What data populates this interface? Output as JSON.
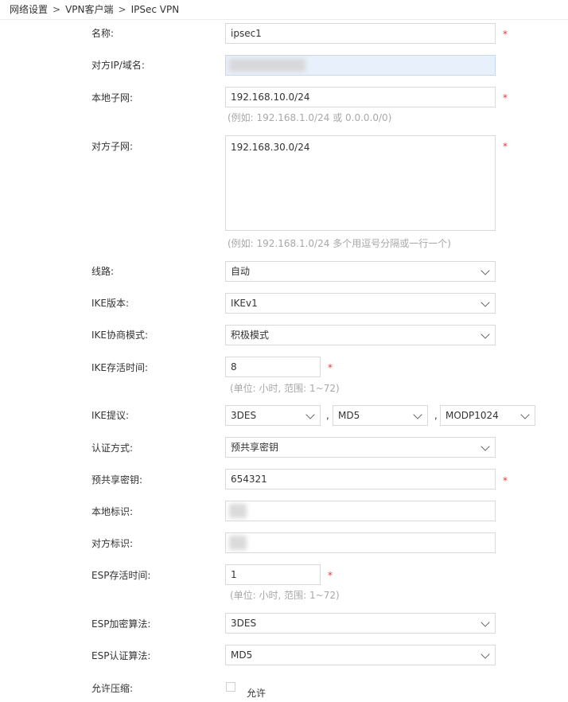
{
  "breadcrumb": {
    "items": [
      "网络设置",
      "VPN客户端",
      "IPSec VPN"
    ],
    "separator": ">"
  },
  "required_mark": "*",
  "form": {
    "name": {
      "label": "名称:",
      "value": "ipsec1"
    },
    "remote_ip": {
      "label": "对方IP/域名:",
      "value": ""
    },
    "local_subnet": {
      "label": "本地子网:",
      "value": "192.168.10.0/24",
      "hint": "(例如: 192.168.1.0/24 或 0.0.0.0/0)"
    },
    "remote_subnet": {
      "label": "对方子网:",
      "value": "192.168.30.0/24",
      "hint": "(例如: 192.168.1.0/24 多个用逗号分隔或一行一个)"
    },
    "line": {
      "label": "线路:",
      "value": "自动"
    },
    "ike_version": {
      "label": "IKE版本:",
      "value": "IKEv1"
    },
    "ike_mode": {
      "label": "IKE协商模式:",
      "value": "积极模式"
    },
    "ike_lifetime": {
      "label": "IKE存活时间:",
      "value": "8",
      "hint": "(单位: 小时, 范围: 1~72)"
    },
    "ike_proposal": {
      "label": "IKE提议:",
      "encryption": "3DES",
      "hash": "MD5",
      "dh_group": "MODP1024",
      "separator": ","
    },
    "auth_method": {
      "label": "认证方式:",
      "value": "预共享密钥"
    },
    "psk": {
      "label": "预共享密钥:",
      "value": "654321"
    },
    "local_id": {
      "label": "本地标识:",
      "value": ""
    },
    "remote_id": {
      "label": "对方标识:",
      "value": ""
    },
    "esp_lifetime": {
      "label": "ESP存活时间:",
      "value": "1",
      "hint": "(单位: 小时, 范围: 1~72)"
    },
    "esp_encryption": {
      "label": "ESP加密算法:",
      "value": "3DES"
    },
    "esp_auth": {
      "label": "ESP认证算法:",
      "value": "MD5"
    },
    "compression": {
      "label": "允许压缩:",
      "checkbox_label": "允许",
      "checked": false
    }
  }
}
